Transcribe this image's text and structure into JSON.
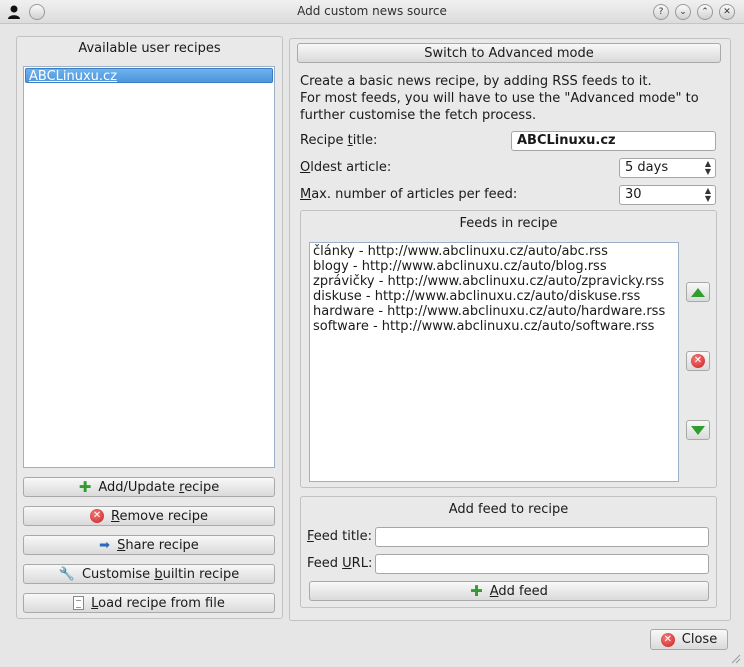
{
  "window": {
    "title": "Add custom news source",
    "buttons": [
      "?",
      "⌄",
      "⌃",
      "✕"
    ]
  },
  "left": {
    "group_title": "Available user recipes",
    "recipes": [
      "ABCLinuxu.cz"
    ],
    "buttons": {
      "add_update": {
        "pre": "Add/Update ",
        "mnemonic": "r",
        "post": "ecipe",
        "icon": "plus-green-icon"
      },
      "remove": {
        "pre": "",
        "mnemonic": "R",
        "post": "emove recipe",
        "icon": "red-x-icon"
      },
      "share": {
        "pre": "",
        "mnemonic": "S",
        "post": "hare recipe",
        "icon": "arrow-right-icon"
      },
      "customise": {
        "pre": "Customise ",
        "mnemonic": "b",
        "post": "uiltin recipe",
        "icon": "wrench-icon"
      },
      "load": {
        "pre": "",
        "mnemonic": "L",
        "post": "oad recipe from file",
        "icon": "document-icon"
      }
    }
  },
  "right": {
    "switch_label": "Switch to Advanced mode",
    "description_line1": "Create a basic news recipe, by adding RSS feeds to it.",
    "description_line2": "For most feeds, you will have to use the \"Advanced mode\" to",
    "description_line3": "further customise the fetch process.",
    "recipe_title": {
      "pre": "Recipe ",
      "mnemonic": "t",
      "post": "itle:",
      "value": "ABCLinuxu.cz"
    },
    "oldest_article": {
      "pre": "",
      "mnemonic": "O",
      "post": "ldest article:",
      "value": "5 days"
    },
    "max_articles": {
      "pre": "",
      "mnemonic": "M",
      "post": "ax. number of articles per feed:",
      "value": "30"
    },
    "feeds_group_title": "Feeds in recipe",
    "feeds": [
      "články - http://www.abclinuxu.cz/auto/abc.rss",
      "blogy - http://www.abclinuxu.cz/auto/blog.rss",
      "zprávičky - http://www.abclinuxu.cz/auto/zpravicky.rss",
      "diskuse - http://www.abclinuxu.cz/auto/diskuse.rss",
      "hardware - http://www.abclinuxu.cz/auto/hardware.rss",
      "software - http://www.abclinuxu.cz/auto/software.rss"
    ],
    "add_feed_group_title": "Add feed to recipe",
    "feed_title_label": {
      "pre": "",
      "mnemonic": "F",
      "post": "eed title:"
    },
    "feed_title_value": "",
    "feed_url_label": {
      "pre": "Feed ",
      "mnemonic": "U",
      "post": "RL:"
    },
    "feed_url_value": "",
    "add_feed_button": {
      "pre": "",
      "mnemonic": "A",
      "post": "dd feed"
    }
  },
  "footer": {
    "close_label": "Close"
  },
  "colors": {
    "selection": "#4c96dc",
    "add_icon": "#2f9e2f",
    "remove_icon": "#cc1f1f"
  }
}
